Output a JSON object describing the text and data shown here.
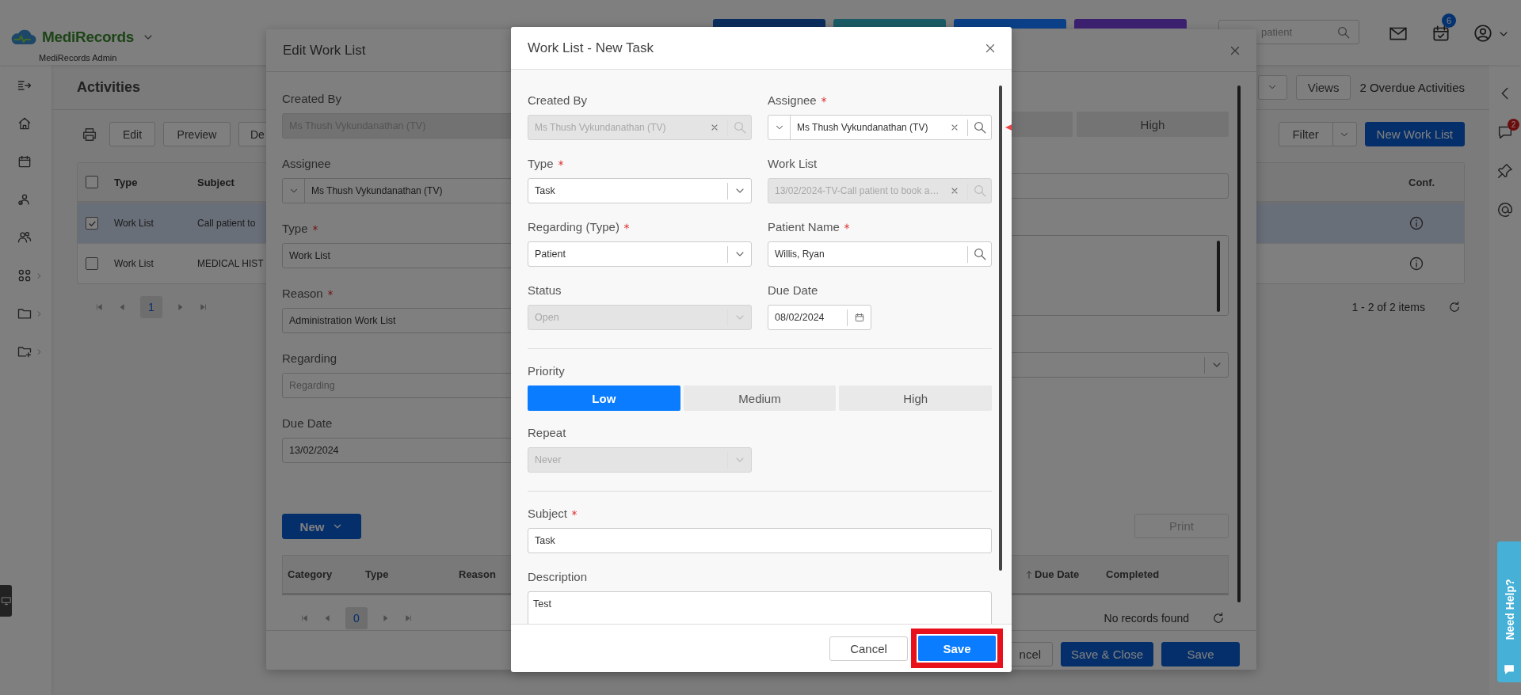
{
  "header": {
    "logo": "MediRecords",
    "subtitle": "MediRecords Admin",
    "shortcut_buttons": [
      {
        "color": "#0c2e5e"
      },
      {
        "color": "#1b5c66"
      },
      {
        "color": "#0b4088"
      },
      {
        "color": "#3c2070"
      }
    ],
    "search": {
      "placeholder": "patient"
    },
    "tasks_badge": "6"
  },
  "sidebar": {
    "items": [
      {
        "kind": "toggle",
        "has_submenu": false
      },
      {
        "kind": "home",
        "has_submenu": false
      },
      {
        "kind": "calendar",
        "has_submenu": false
      },
      {
        "kind": "patients",
        "has_submenu": false
      },
      {
        "kind": "contacts",
        "has_submenu": false
      },
      {
        "kind": "apps",
        "has_submenu": true
      },
      {
        "kind": "folder",
        "has_submenu": true
      },
      {
        "kind": "folder-add",
        "has_submenu": true
      }
    ]
  },
  "activities": {
    "title": "Activities",
    "views_button": "Views",
    "overdue": "2 Overdue Activities",
    "toolbar": [
      "Edit",
      "Preview",
      "De"
    ],
    "filter_button": "Filter",
    "new_button": "New Work List",
    "table": {
      "columns": [
        "Type",
        "Subject",
        "Conf."
      ],
      "header_checked": false,
      "rows": [
        {
          "checked": true,
          "selected": true,
          "cells": [
            "Work List",
            "Call patient to"
          ]
        },
        {
          "checked": false,
          "selected": false,
          "cells": [
            "Work List",
            "MEDICAL HIST"
          ]
        }
      ]
    },
    "pager": {
      "pages": [
        {
          "label": "1",
          "selected": true
        }
      ]
    },
    "summary": "1 - 2 of 2 items"
  },
  "right_rail": {
    "chat_badge": "2",
    "help": "Need Help?"
  },
  "edit_dialog": {
    "title": "Edit Work List",
    "fields": [
      {
        "label": "Created By",
        "required": false,
        "kind": "text",
        "value": "Ms Thush Vykundanathan (TV)",
        "disabled": true
      },
      {
        "label": "Assignee",
        "required": false,
        "kind": "lookup",
        "dropdown": true,
        "value": "Ms Thush Vykundanathan (TV)",
        "disabled": false
      },
      {
        "label": "Type",
        "required": true,
        "kind": "text",
        "value": "Work List",
        "disabled": false
      },
      {
        "label": "Reason",
        "required": true,
        "kind": "text",
        "value": "Administration Work List",
        "disabled": false
      },
      {
        "label": "Regarding",
        "required": false,
        "kind": "text",
        "placeholder": "Regarding",
        "disabled": false
      },
      {
        "label": "Due Date",
        "required": false,
        "kind": "text",
        "value": "13/02/2024",
        "disabled": false
      }
    ],
    "side_controls": [
      {
        "kind": "priority",
        "label": "High"
      },
      {
        "kind": "text"
      },
      {
        "kind": "textarea"
      },
      {
        "kind": "select"
      }
    ],
    "new_button": "New",
    "print_button": "Print",
    "grid": {
      "leading_columns": [
        {
          "label": "Category"
        },
        {
          "label": "Type"
        },
        {
          "label": "Reason"
        }
      ],
      "trailing_columns": [
        {
          "label": "Due Date",
          "sorted": true
        },
        {
          "label": "Completed"
        }
      ]
    },
    "pager": {
      "pages": [
        {
          "label": "0",
          "selected": true
        }
      ]
    },
    "empty": "No records found",
    "footer_buttons": [
      {
        "label": "ncel",
        "kind": "secondary"
      },
      {
        "label": "Save & Close",
        "kind": "primary"
      },
      {
        "label": "Save",
        "kind": "primary"
      }
    ]
  },
  "task_dialog": {
    "title": "Work List - New Task",
    "details": [
      {
        "label": "Created By",
        "required": false,
        "kind": "lookup",
        "value": "Ms Thush Vykundanathan (TV)",
        "disabled": true,
        "clearable": true,
        "searchable": true
      },
      {
        "label": "Assignee",
        "required": true,
        "kind": "lookup",
        "dropdown": true,
        "value": "Ms Thush Vykundanathan (TV)",
        "disabled": false,
        "clearable": true,
        "searchable": true,
        "pointed": true
      },
      {
        "label": "Type",
        "required": true,
        "kind": "select",
        "value": "Task",
        "disabled": false
      },
      {
        "label": "Work List",
        "required": false,
        "kind": "lookup",
        "value": "13/02/2024-TV-Call patient to book a…",
        "disabled": true,
        "clearable": true,
        "searchable": true
      },
      {
        "label": "Regarding (Type)",
        "required": true,
        "kind": "select",
        "value": "Patient",
        "disabled": false
      },
      {
        "label": "Patient Name",
        "required": true,
        "kind": "lookup",
        "value": "Willis, Ryan",
        "disabled": false,
        "searchable": true
      },
      {
        "label": "Status",
        "required": false,
        "kind": "select",
        "value": "Open",
        "disabled": true
      },
      {
        "label": "Due Date",
        "required": false,
        "kind": "date",
        "value": "08/02/2024",
        "disabled": false
      }
    ],
    "priority": {
      "label": "Priority",
      "options": [
        {
          "label": "Low",
          "selected": true
        },
        {
          "label": "Medium",
          "selected": false
        },
        {
          "label": "High",
          "selected": false
        }
      ]
    },
    "repeat": {
      "label": "Repeat",
      "required": false,
      "kind": "select",
      "value": "Never",
      "disabled": true
    },
    "subject": {
      "label": "Subject",
      "required": true,
      "kind": "text",
      "value": "Task",
      "disabled": false
    },
    "description": {
      "label": "Description",
      "required": false,
      "kind": "textarea",
      "value": "Test",
      "disabled": false
    },
    "footer_buttons": [
      {
        "label": "Cancel",
        "kind": "secondary",
        "highlighted": false
      },
      {
        "label": "Save",
        "kind": "primary",
        "highlighted": true
      }
    ]
  }
}
